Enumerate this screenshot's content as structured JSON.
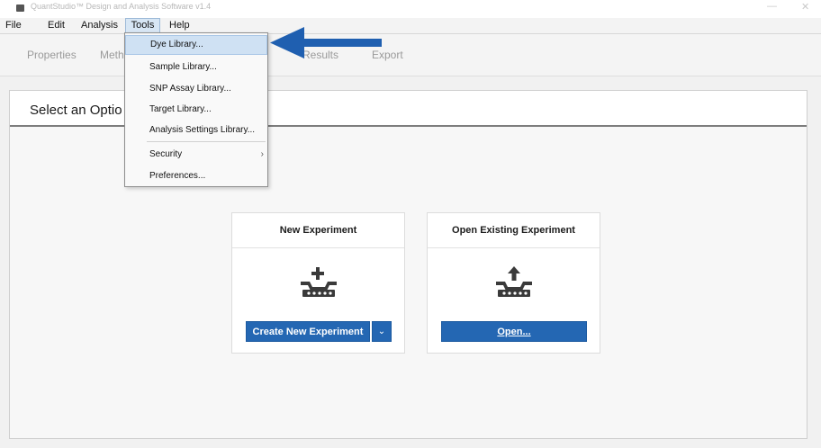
{
  "titlebar": {
    "title": "QuantStudio™ Design and Analysis Software v1.4",
    "minimize": "—",
    "close": "✕"
  },
  "menubar": {
    "items": [
      "File",
      "Edit",
      "Analysis",
      "Tools",
      "Help"
    ],
    "active": "Tools"
  },
  "nav": {
    "tabs": [
      "Properties",
      "Meth",
      "Results",
      "Export"
    ]
  },
  "content": {
    "title": "Select an Optio"
  },
  "cards": {
    "new": {
      "title": "New Experiment",
      "button_label": "Create New Experiment",
      "dropdown_glyph": "⌄"
    },
    "open": {
      "title": "Open Existing Experiment",
      "button_label": "Open..."
    }
  },
  "tools_menu": {
    "items": [
      {
        "label": "Dye Library...",
        "highlighted": true
      },
      {
        "label": "Sample Library..."
      },
      {
        "label": "SNP Assay Library..."
      },
      {
        "label": "Target Library..."
      },
      {
        "label": "Analysis Settings Library..."
      },
      {
        "label": "Security",
        "submenu": "›"
      },
      {
        "label": "Preferences..."
      }
    ]
  },
  "annotation": {
    "arrow_color": "#1f5fb0",
    "icon": "arrow-left-icon"
  },
  "colors": {
    "accent": "#2467b3",
    "menu_highlight": "#cfe1f3"
  }
}
